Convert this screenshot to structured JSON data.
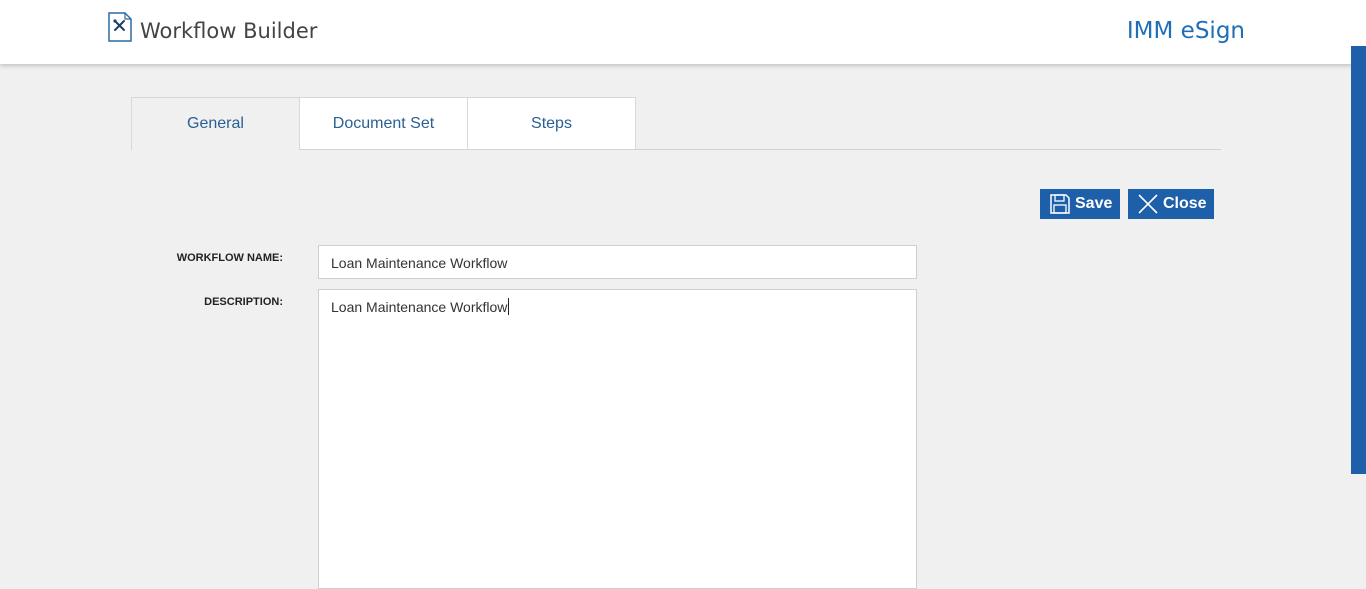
{
  "header": {
    "title": "Workflow Builder",
    "brand": "IMM eSign",
    "icon": "document-tools-icon"
  },
  "tabs": [
    {
      "label": "General",
      "active": true
    },
    {
      "label": "Document Set",
      "active": false
    },
    {
      "label": "Steps",
      "active": false
    }
  ],
  "toolbar": {
    "save_label": "Save",
    "close_label": "Close"
  },
  "form": {
    "workflow_name_label": "WORKFLOW NAME:",
    "workflow_name_value": "Loan Maintenance Workflow",
    "description_label": "DESCRIPTION:",
    "description_value": "Loan Maintenance Workflow"
  },
  "colors": {
    "accent": "#1d60a9",
    "brand_text": "#1e6fb7",
    "background": "#f0f0f0"
  }
}
